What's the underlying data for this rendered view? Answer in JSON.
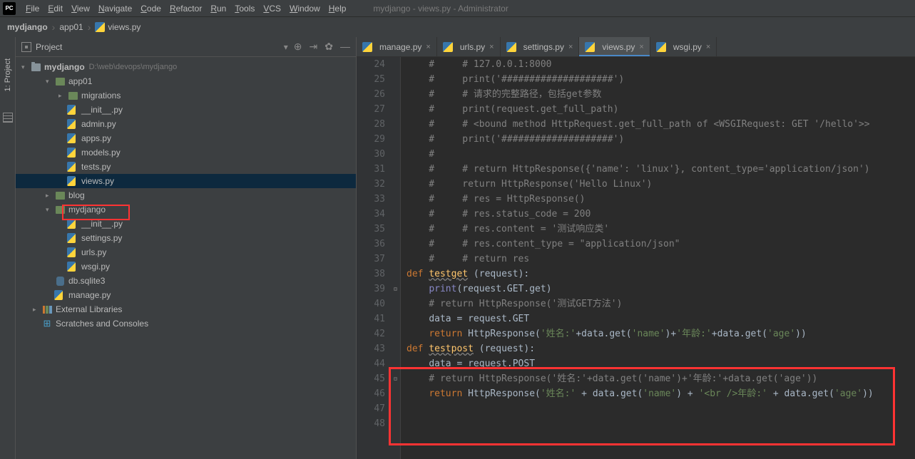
{
  "menu": [
    "File",
    "Edit",
    "View",
    "Navigate",
    "Code",
    "Refactor",
    "Run",
    "Tools",
    "VCS",
    "Window",
    "Help"
  ],
  "title": "mydjango - views.py - Administrator",
  "breadcrumbs": [
    "mydjango",
    "app01",
    "views.py"
  ],
  "sidebar": {
    "header": "Project",
    "root": {
      "name": "mydjango",
      "path": "D:\\web\\devops\\mydjango"
    },
    "tree": [
      {
        "d": 1,
        "t": "v",
        "i": "dir",
        "n": "app01"
      },
      {
        "d": 2,
        "t": ">",
        "i": "dir",
        "n": "migrations"
      },
      {
        "d": 2,
        "t": "",
        "i": "py",
        "n": "__init__.py"
      },
      {
        "d": 2,
        "t": "",
        "i": "py",
        "n": "admin.py"
      },
      {
        "d": 2,
        "t": "",
        "i": "py",
        "n": "apps.py"
      },
      {
        "d": 2,
        "t": "",
        "i": "py",
        "n": "models.py"
      },
      {
        "d": 2,
        "t": "",
        "i": "py",
        "n": "tests.py"
      },
      {
        "d": 2,
        "t": "",
        "i": "py",
        "n": "views.py",
        "sel": true
      },
      {
        "d": 1,
        "t": ">",
        "i": "dir",
        "n": "blog"
      },
      {
        "d": 1,
        "t": "v",
        "i": "dir",
        "n": "mydjango"
      },
      {
        "d": 2,
        "t": "",
        "i": "py",
        "n": "__init__.py"
      },
      {
        "d": 2,
        "t": "",
        "i": "py",
        "n": "settings.py"
      },
      {
        "d": 2,
        "t": "",
        "i": "py",
        "n": "urls.py"
      },
      {
        "d": 2,
        "t": "",
        "i": "py",
        "n": "wsgi.py"
      },
      {
        "d": 1,
        "t": "",
        "i": "db",
        "n": "db.sqlite3"
      },
      {
        "d": 1,
        "t": "",
        "i": "py",
        "n": "manage.py"
      },
      {
        "d": 0,
        "t": ">",
        "i": "lib",
        "n": "External Libraries"
      },
      {
        "d": 0,
        "t": "",
        "i": "scratch",
        "n": "Scratches and Consoles"
      }
    ]
  },
  "tabs": [
    {
      "l": "manage.py"
    },
    {
      "l": "urls.py"
    },
    {
      "l": "settings.py"
    },
    {
      "l": "views.py",
      "active": true
    },
    {
      "l": "wsgi.py"
    }
  ],
  "code": {
    "start": 24,
    "lines": [
      "    #     # 127.0.0.1:8000",
      "    #     print('####################')",
      "    #     # 请求的完整路径，包括get参数",
      "    #     print(request.get_full_path)",
      "    #     # <bound method HttpRequest.get_full_path of <WSGIRequest: GET '/hello'>>",
      "    #     print('####################')",
      "    #",
      "    #     # return HttpResponse({'name': 'linux'}, content_type='application/json')",
      "    #     return HttpResponse('Hello Linux')",
      "    #     # res = HttpResponse()",
      "    #     # res.status_code = 200",
      "    #     # res.content = '测试响应类'",
      "    #     # res.content_type = \"application/json\"",
      "    #     # return res",
      "",
      "def testget (request):",
      "    print(request.GET.get)",
      "    # return HttpResponse('测试GET方法')",
      "    data = request.GET",
      "    return HttpResponse('姓名:'+data.get('name')+'年龄:'+data.get('age'))",
      "",
      "def testpost (request):",
      "    data = request.POST",
      "    # return HttpResponse('姓名:'+data.get('name')+'年龄:'+data.get('age'))",
      "    return HttpResponse('姓名:' + data.get('name') + '<br />年龄:' + data.get('age'))"
    ]
  },
  "left_tool": {
    "project": "1: Project"
  }
}
